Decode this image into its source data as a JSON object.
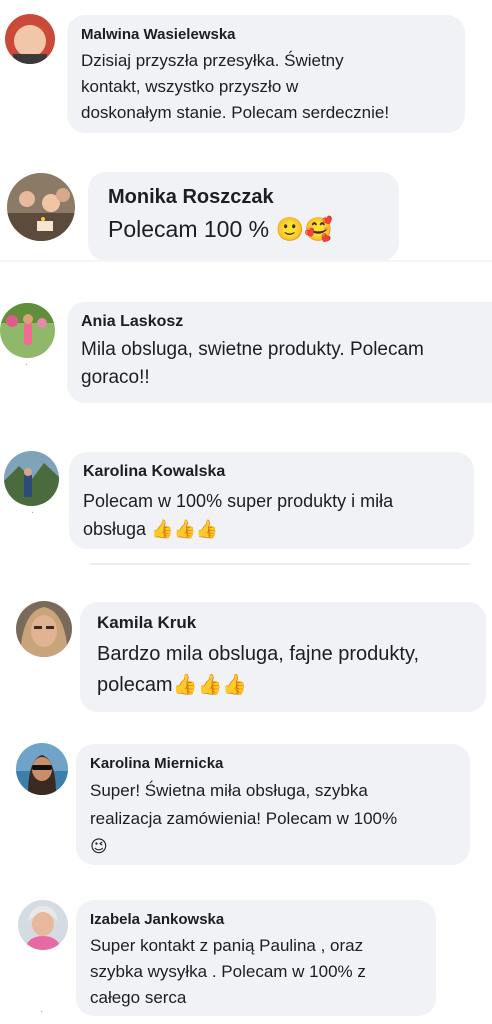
{
  "reviews": [
    {
      "name": "Malwina Wasielewska",
      "text": "Dzisiaj przyszła przesyłka. Świetny\nkontakt, wszystko  przyszło w\ndoskonałym stanie. Polecam serdecznie!",
      "emoji": ""
    },
    {
      "name": "Monika Roszczak",
      "text": "Polecam 100 % ",
      "emoji": "🙂🥰"
    },
    {
      "name": "Ania Laskosz",
      "text": "Mila obsluga, swietne produkty. Polecam\ngoraco!!",
      "emoji": ""
    },
    {
      "name": "Karolina Kowalska",
      "text": "Polecam w 100% super produkty i miła\nobsługa ",
      "emoji": "👍👍👍"
    },
    {
      "name": "Kamila Kruk",
      "text": "Bardzo mila obsluga, fajne produkty,\npolecam",
      "emoji": "👍👍👍"
    },
    {
      "name": "Karolina Miernicka",
      "text": "Super! Świetna miła obsługa, szybka\nrealizacja zamówienia! Polecam w 100%\n",
      "emoji": "😉"
    },
    {
      "name": "Izabela Jankowska",
      "text": "Super kontakt z panią Paulina , oraz\nszybka wysyłka . Polecam w 100% z\ncałego serca",
      "emoji": ""
    }
  ],
  "colors": {
    "bubble": "#f0f2f5",
    "text": "#1c1e21"
  }
}
